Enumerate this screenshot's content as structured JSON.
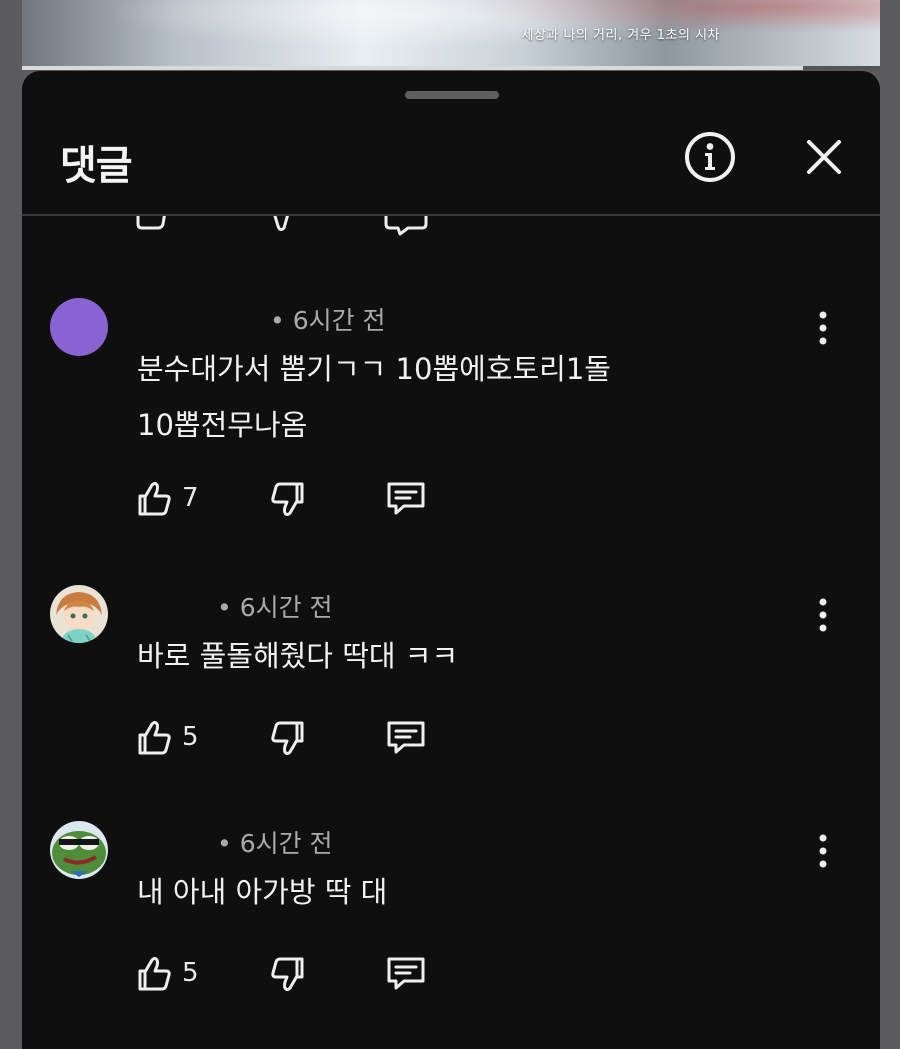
{
  "video": {
    "caption": "세상과 나의 거리, 겨우 1초의 시차",
    "progress": 0.91
  },
  "header": {
    "title": "댓글"
  },
  "comments": [
    {
      "time": "• 6시간 전",
      "text_lines": [
        "분수대가서 뽑기ㄱㄱ 10뽑에호토리1돌",
        "10뽑전무나옴"
      ],
      "likes": "7",
      "avatar": "purple-circle-avatar",
      "avatar_color": "#8a63d2"
    },
    {
      "time": "• 6시간 전",
      "text_lines": [
        "바로 풀돌해줬다 딱대 ㅋㅋ"
      ],
      "likes": "5",
      "avatar": "anime-character-avatar"
    },
    {
      "time": "• 6시간 전",
      "text_lines": [
        "내 아내 아가방 딱 대"
      ],
      "likes": "5",
      "avatar": "frog-avatar"
    }
  ],
  "icons": {
    "info": "info-icon",
    "close": "close-icon",
    "like": "thumbs-up-icon",
    "dislike": "thumbs-down-icon",
    "reply": "reply-icon",
    "more": "more-vertical-icon"
  }
}
